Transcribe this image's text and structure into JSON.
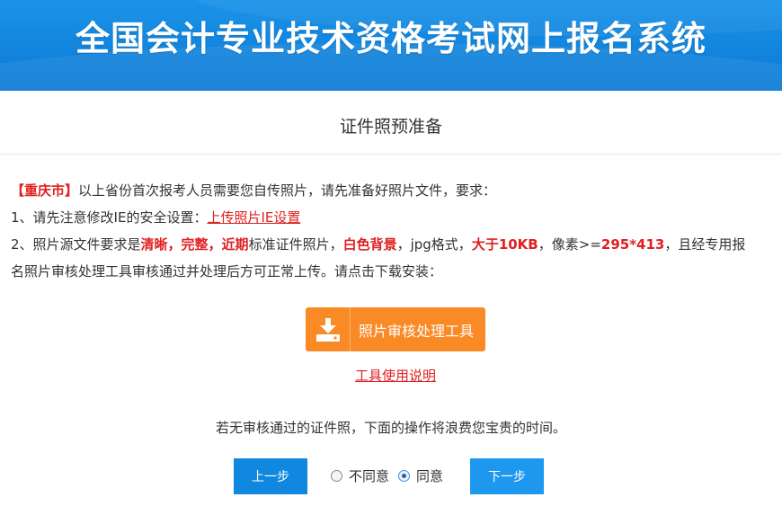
{
  "header": {
    "title": "全国会计专业技术资格考试网上报名系统"
  },
  "section": {
    "title": "证件照预准备"
  },
  "notice": {
    "city_bracket_open": "【",
    "city": "重庆市",
    "city_bracket_close": "】",
    "intro": "以上省份首次报考人员需要您自传照片，请先准备好照片文件，要求：",
    "item1_prefix": "1、请先注意修改IE的安全设置：",
    "item1_link": "上传照片IE设置",
    "item2_prefix": "2、照片源文件要求是",
    "item2_clarity": "清晰，完整，近期",
    "item2_mid1": "标准证件照片，",
    "item2_bg": "白色背景",
    "item2_mid2": "，jpg格式，",
    "item2_size": "大于10KB",
    "item2_mid3": "，像素>=",
    "item2_pixels": "295*413",
    "item2_tail": "，且经专用报",
    "item2_line2": "名照片审核处理工具审核通过并处理后方可正常上传。请点击下载安装："
  },
  "download": {
    "icon": "download-icon",
    "label": "照片审核处理工具"
  },
  "tool_link": {
    "label": "工具使用说明"
  },
  "warning": {
    "text": "若无审核通过的证件照，下面的操作将浪费您宝贵的时间。"
  },
  "nav": {
    "prev_label": "上一步",
    "next_label": "下一步",
    "disagree_label": "不同意",
    "agree_label": "同意",
    "selected": "agree"
  },
  "colors": {
    "banner": "#1183dc",
    "accent_red": "#e02020",
    "download_orange": "#f98a25",
    "button_blue": "#1188e0"
  }
}
